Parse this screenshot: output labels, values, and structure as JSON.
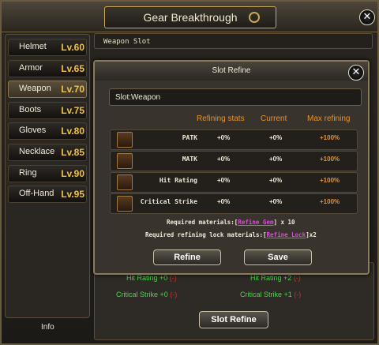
{
  "window": {
    "title": "Gear Breakthrough"
  },
  "sidebar": {
    "items": [
      {
        "label": "Helmet",
        "level": "Lv.60"
      },
      {
        "label": "Armor",
        "level": "Lv.65"
      },
      {
        "label": "Weapon",
        "level": "Lv.70",
        "active": true
      },
      {
        "label": "Boots",
        "level": "Lv.75"
      },
      {
        "label": "Gloves",
        "level": "Lv.80"
      },
      {
        "label": "Necklace",
        "level": "Lv.85"
      },
      {
        "label": "Ring",
        "level": "Lv.90"
      },
      {
        "label": "Off-Hand",
        "level": "Lv.95"
      }
    ],
    "info_label": "Info"
  },
  "main": {
    "slot_bar_label": "Weapon Slot",
    "bottom_stats": [
      {
        "name": "Hit Rating",
        "value": "+0",
        "extra": "(-)"
      },
      {
        "name": "Hit Rating",
        "value": "+2",
        "extra": "(-)"
      },
      {
        "name": "Critical Strike",
        "value": "+0",
        "extra": "(-)"
      },
      {
        "name": "Critical Strike",
        "value": "+1",
        "extra": "(-)"
      }
    ],
    "slot_refine_button": "Slot Refine"
  },
  "popup": {
    "title": "Slot Refine",
    "slot_field": "Slot:Weapon",
    "columns": {
      "refining": "Refining stats",
      "current": "Current",
      "max": "Max refining"
    },
    "rows": [
      {
        "name": "PATK",
        "refining": "+0%",
        "current": "+0%",
        "max": "+100%"
      },
      {
        "name": "MATK",
        "refining": "+0%",
        "current": "+0%",
        "max": "+100%"
      },
      {
        "name": "Hit Rating",
        "refining": "+0%",
        "current": "+0%",
        "max": "+100%"
      },
      {
        "name": "Critical Strike",
        "refining": "+0%",
        "current": "+0%",
        "max": "+100%"
      }
    ],
    "required_materials": {
      "prefix": "Required materials:[",
      "item": "Refine Gem",
      "suffix": "] x 10"
    },
    "required_lock": {
      "prefix": "Required refining lock materials:[",
      "item": "Refine Lock",
      "suffix": "]x2"
    },
    "refine_button": "Refine",
    "save_button": "Save"
  },
  "colors": {
    "accent_orange": "#e8922a",
    "level_gold": "#f0c04a",
    "stat_green": "#4fd64f",
    "link_magenta": "#d24fd2"
  },
  "icons": {
    "close": "close-icon",
    "lock": "lock-icon"
  }
}
